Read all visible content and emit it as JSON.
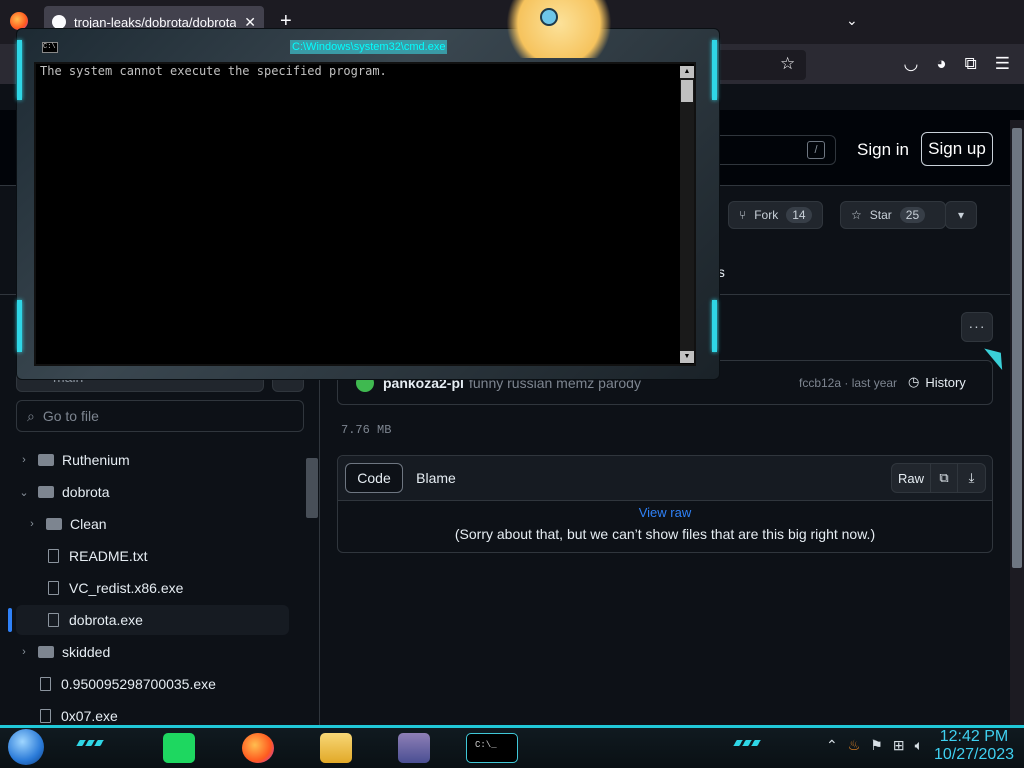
{
  "browser": {
    "tab_title": "trojan-leaks/dobrota/dobrota.e",
    "new_tab": "+",
    "tab_list": "⌄",
    "star_icon": "☆"
  },
  "github": {
    "search_key": "/",
    "sign_in": "Sign in",
    "sign_up": "Sign up",
    "fork_label": "Fork",
    "fork_count": "14",
    "star_label": "Star",
    "star_count": "25",
    "tab_partial": "ts",
    "more_icon": "···"
  },
  "sidebar": {
    "branch": "main",
    "goto_placeholder": "Go to file",
    "tree": [
      {
        "label": "Ruthenium",
        "type": "folder",
        "chev": "›",
        "indent": 0
      },
      {
        "label": "dobrota",
        "type": "folder",
        "chev": "⌄",
        "indent": 0
      },
      {
        "label": "Clean",
        "type": "folder",
        "chev": "›",
        "indent": 1
      },
      {
        "label": "README.txt",
        "type": "file",
        "chev": "",
        "indent": 1
      },
      {
        "label": "VC_redist.x86.exe",
        "type": "file",
        "chev": "",
        "indent": 1
      },
      {
        "label": "dobrota.exe",
        "type": "file",
        "chev": "",
        "indent": 1
      },
      {
        "label": "skidded",
        "type": "folder",
        "chev": "›",
        "indent": 0
      },
      {
        "label": "0.950095298700035.exe",
        "type": "file",
        "chev": "",
        "indent": 0
      },
      {
        "label": "0x07.exe",
        "type": "file",
        "chev": "",
        "indent": 0
      }
    ]
  },
  "commit": {
    "author": "pankoza2-pl",
    "message": "funny russian memz parody",
    "hash_time": "fccb12a · last year",
    "history": "History"
  },
  "file": {
    "size": "7.76 MB",
    "code_tab": "Code",
    "blame_tab": "Blame",
    "raw": "Raw",
    "view_raw": "View raw",
    "notice": "(Sorry about that, but we can’t show files that are this big right now.)"
  },
  "cmd": {
    "title": "C:\\Windows\\system32\\cmd.exe",
    "output": "The system cannot execute the specified program.",
    "icon_text": "C:\\"
  },
  "taskbar": {
    "cmd_label": "C:\\_",
    "time": "12:42 PM",
    "date": "10/27/2023"
  },
  "colors": {
    "accent_cyan": "#2fd6e6",
    "link_blue": "#2f81f7",
    "clock_color": "#3fd0f0"
  }
}
